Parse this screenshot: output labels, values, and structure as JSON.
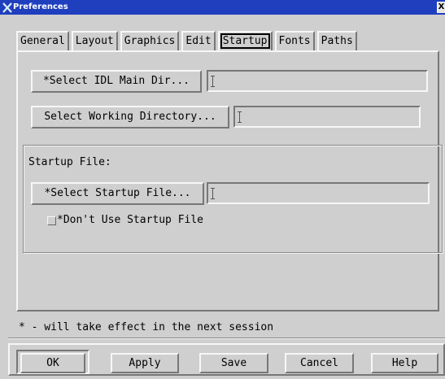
{
  "window": {
    "title": "Preferences",
    "close_glyph": "X"
  },
  "tabs": [
    {
      "label": "General"
    },
    {
      "label": "Layout"
    },
    {
      "label": "Graphics"
    },
    {
      "label": "Edit"
    },
    {
      "label": "Startup",
      "active": true
    },
    {
      "label": "Fonts"
    },
    {
      "label": "Paths"
    }
  ],
  "startup": {
    "select_main_dir_label": "*Select IDL Main Dir...",
    "main_dir_value": "",
    "select_working_dir_label": "Select Working Directory...",
    "working_dir_value": "",
    "group_label": "Startup File:",
    "select_startup_file_label": "*Select Startup File...",
    "startup_file_value": "",
    "dont_use_label": "*Don't Use Startup File",
    "dont_use_checked": false
  },
  "note": "* - will take effect in the next session",
  "buttons": {
    "ok": "OK",
    "apply": "Apply",
    "save": "Save",
    "cancel": "Cancel",
    "help": "Help"
  },
  "colors": {
    "titlebar": "#1f3fbf",
    "background": "#cfcfcf"
  }
}
